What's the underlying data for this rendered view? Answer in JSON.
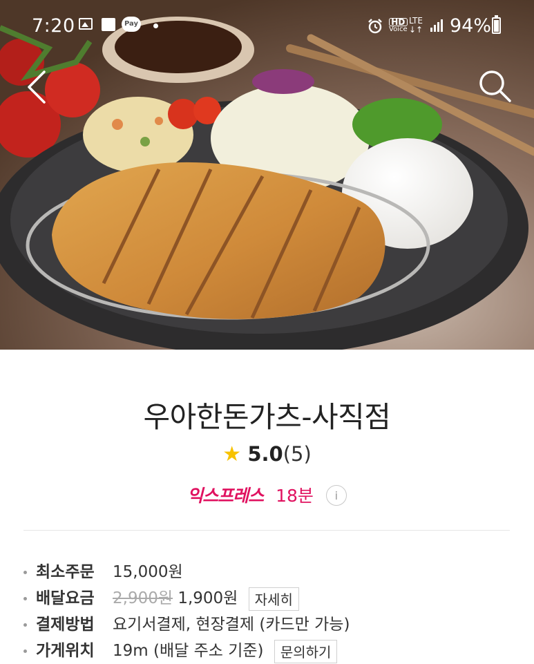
{
  "status_bar": {
    "time": "7:20",
    "pay_label": "Pay",
    "hd_label": "HD",
    "voice_label": "Voice",
    "lte_label": "LTE",
    "battery": "94%",
    "icons": [
      "gallery-icon",
      "note-icon",
      "pay-icon",
      "dot-icon",
      "alarm-icon",
      "hd-voice-icon",
      "lte-icon",
      "signal-icon",
      "battery-icon"
    ]
  },
  "nav": {
    "back_icon": "chevron-left-icon",
    "search_icon": "search-icon"
  },
  "store": {
    "name": "우아한돈가츠-사직점",
    "rating_score": "5.0",
    "rating_count": "(5)",
    "delivery_type": "익스프레스",
    "delivery_time": "18분",
    "info_icon": "i"
  },
  "details": [
    {
      "label": "최소주문",
      "value": "15,000원"
    },
    {
      "label": "배달요금",
      "old_price": "2,900원",
      "value": "1,900원",
      "button": "자세히"
    },
    {
      "label": "결제방법",
      "value": "요기서결제, 현장결제 (카드만 가능)"
    },
    {
      "label": "가게위치",
      "value": "19m (배달 주소 기준)",
      "button": "문의하기"
    }
  ],
  "colors": {
    "accent": "#e0115f",
    "star": "#f7c200"
  }
}
